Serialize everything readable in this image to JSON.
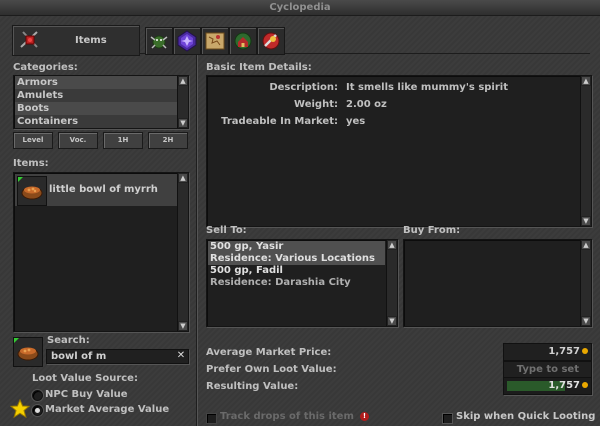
{
  "window": {
    "title": "Cyclopedia"
  },
  "tabs": {
    "items_label": "Items"
  },
  "left": {
    "categories_label": "Categories:",
    "categories": [
      "Armors",
      "Amulets",
      "Boots",
      "Containers"
    ],
    "filter_buttons": [
      "Level",
      "Voc.",
      "1H",
      "2H"
    ],
    "items_label": "Items:",
    "items": [
      {
        "name": "little bowl of myrrh"
      }
    ],
    "search_label": "Search:",
    "search_value": "bowl of m",
    "loot_source_label": "Loot Value Source:",
    "loot_options": [
      "NPC Buy Value",
      "Market Average Value"
    ],
    "loot_selected": "Market Average Value"
  },
  "details": {
    "header": "Basic Item Details:",
    "rows": [
      {
        "key": "Description:",
        "value": "It smells like mummy's spirit"
      },
      {
        "key": "Weight:",
        "value": "2.00 oz"
      },
      {
        "key": "Tradeable In Market:",
        "value": "yes"
      }
    ]
  },
  "sell_to": {
    "label": "Sell To:",
    "entries": [
      {
        "line1": "500 gp, Yasir",
        "line2": "Residence: Various Locations"
      },
      {
        "line1": "500 gp, Fadil",
        "line2": "Residence: Darashia City"
      }
    ]
  },
  "buy_from": {
    "label": "Buy From:"
  },
  "values": {
    "avg_market_label": "Average Market Price:",
    "avg_market_value": "1,757",
    "own_loot_label": "Prefer Own Loot Value:",
    "own_loot_placeholder": "Type to set",
    "resulting_label": "Resulting Value:",
    "resulting_value": "1,757"
  },
  "footer": {
    "track_drops": "Track drops of this item",
    "skip_quick_looting": "Skip when Quick Looting"
  },
  "colors": {
    "accent_gold": "#e9a800",
    "selected_row": "#505050",
    "green_field": "#2a5a2a"
  }
}
